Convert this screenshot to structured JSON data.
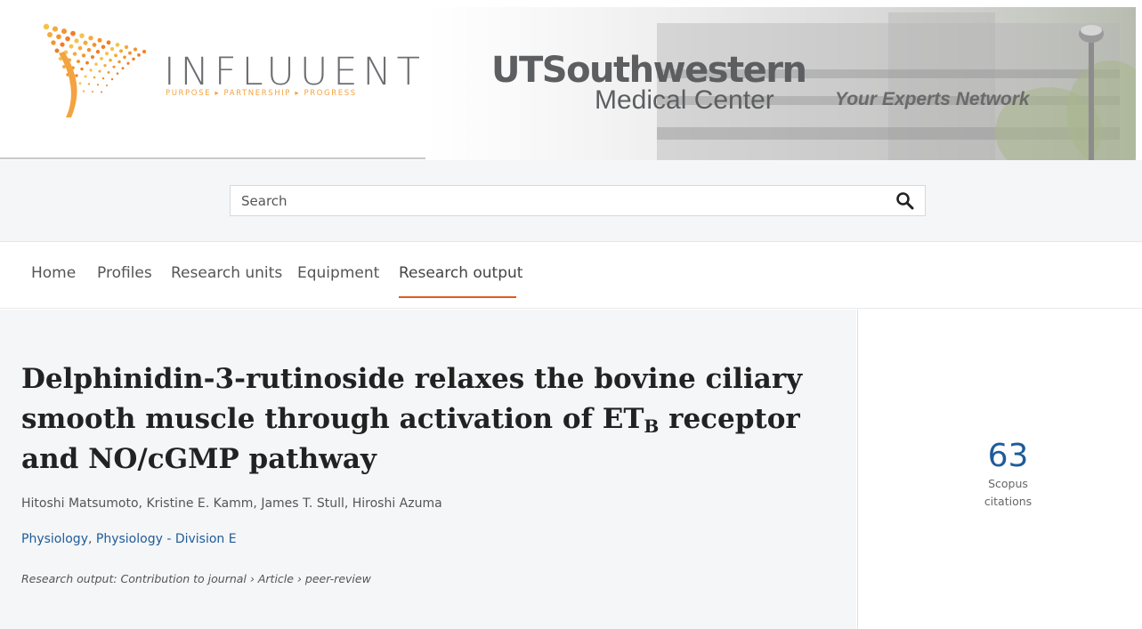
{
  "header": {
    "logo_word": "INFLUUENT",
    "logo_tagline": "PURPOSE ▸ PARTNERSHIP ▸ PROGRESS",
    "plus": "+",
    "ut_title": "UTSouthwestern",
    "ut_subtitle": "Medical Center",
    "ut_tagline": "Your Experts Network",
    "brand_colors": {
      "influuent_orange": "#f4a340",
      "link_blue": "#1f5c99",
      "accent_orange": "#e35a1a"
    }
  },
  "search": {
    "placeholder": "Search",
    "icon": "search-icon"
  },
  "nav": {
    "items": [
      {
        "label": "Home",
        "active": false
      },
      {
        "label": "Profiles",
        "active": false
      },
      {
        "label": "Research units",
        "active": false
      },
      {
        "label": "Equipment",
        "active": false
      },
      {
        "label": "Research output",
        "active": true
      }
    ]
  },
  "article": {
    "title_part1": "Delphinidin-3-rutinoside relaxes the bovine ciliary smooth muscle through activation of ET",
    "title_sub": "B",
    "title_part2": " receptor and NO/cGMP pathway",
    "authors": "Hitoshi Matsumoto, Kristine E. Kamm, James T. Stull, Hiroshi Azuma",
    "units": [
      "Physiology",
      "Physiology - Division E"
    ],
    "unit_separator": ", ",
    "output_type": "Research output: Contribution to journal › Article › peer-review"
  },
  "metrics": {
    "citations_count": "63",
    "citations_label_line1": "Scopus",
    "citations_label_line2": "citations"
  }
}
